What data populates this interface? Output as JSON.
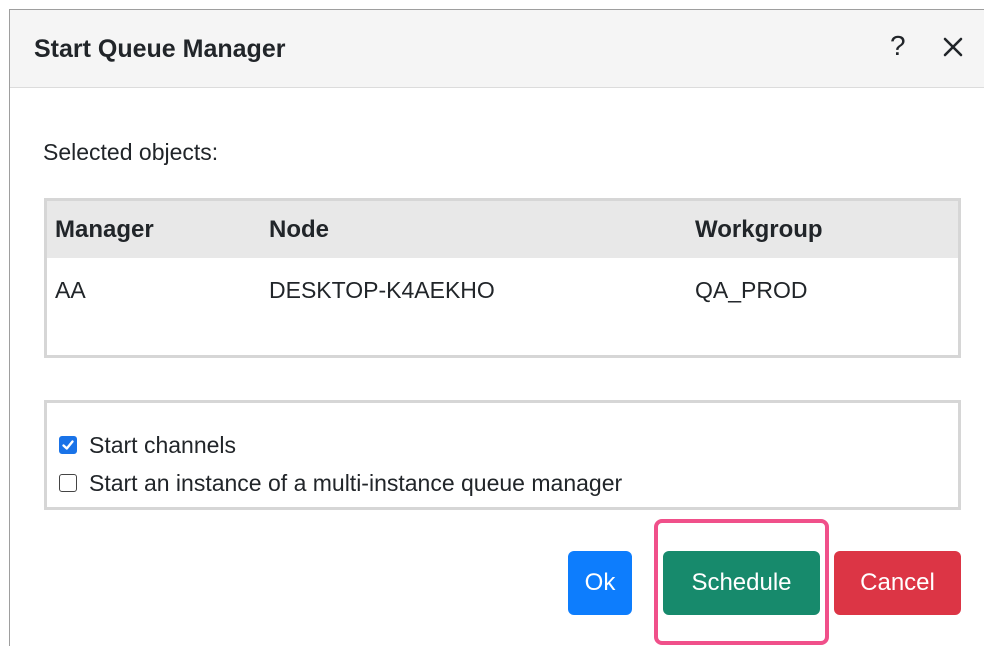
{
  "dialog": {
    "title": "Start Queue Manager",
    "help_glyph": "?",
    "close_icon": "close-icon"
  },
  "selected_label": "Selected objects:",
  "table": {
    "columns": [
      "Manager",
      "Node",
      "Workgroup"
    ],
    "rows": [
      [
        "AA",
        "DESKTOP-K4AEKHO",
        "QA_PROD"
      ]
    ]
  },
  "options": [
    {
      "label": "Start channels",
      "checked": true
    },
    {
      "label": "Start an instance of a multi-instance queue manager",
      "checked": false
    }
  ],
  "buttons": {
    "ok": "Ok",
    "schedule": "Schedule",
    "cancel": "Cancel"
  },
  "colors": {
    "ok": "#0d7dfd",
    "schedule": "#178a6c",
    "cancel": "#dc3545",
    "highlight": "#f0508a",
    "checkbox": "#1a73e8"
  }
}
